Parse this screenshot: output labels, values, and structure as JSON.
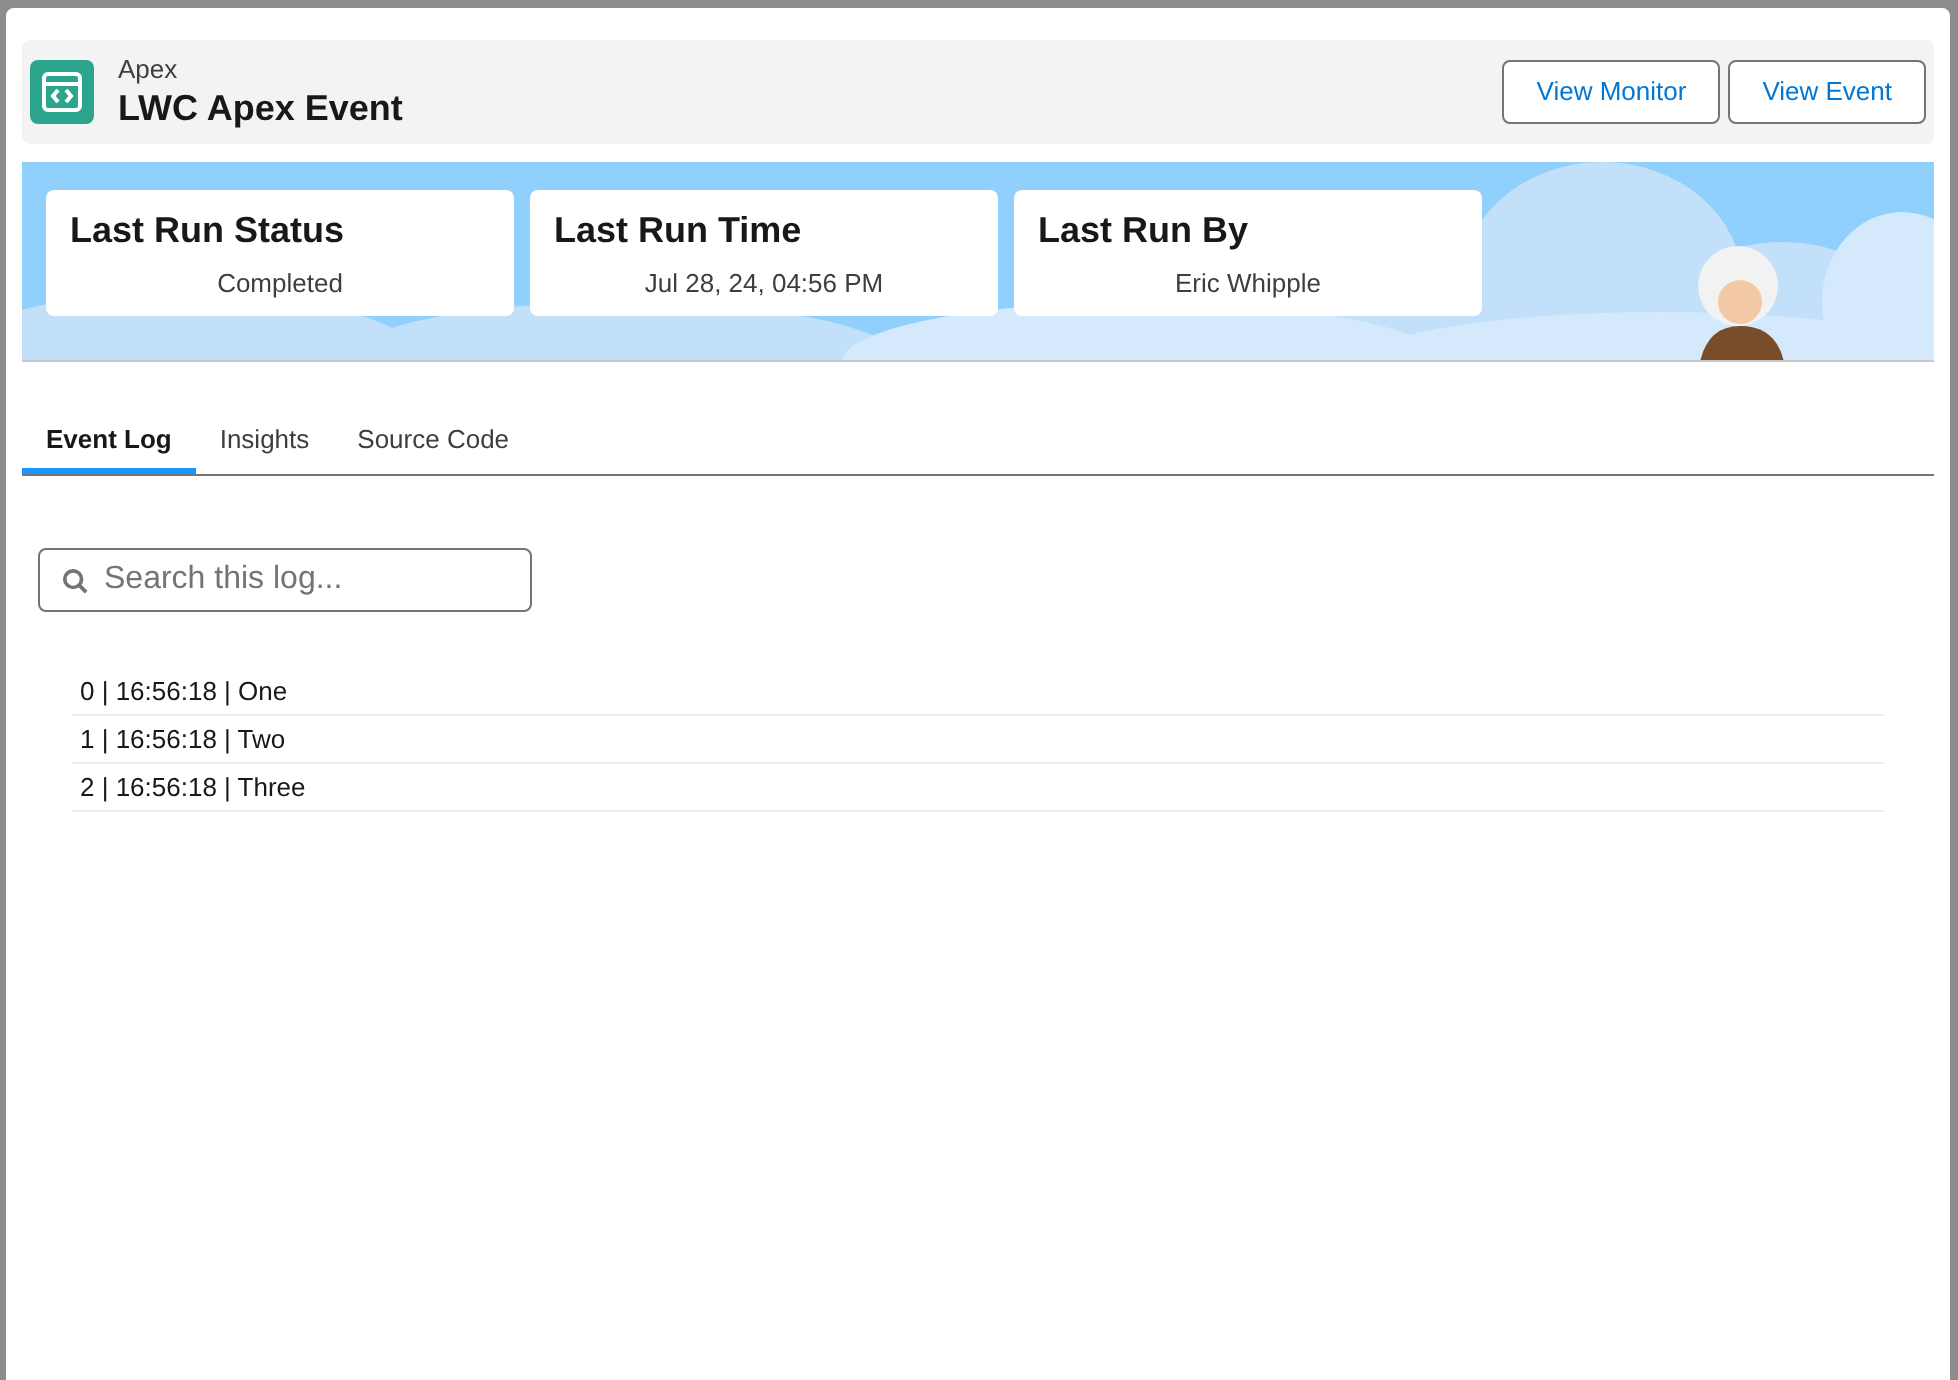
{
  "header": {
    "subtitle": "Apex",
    "title": "LWC Apex Event",
    "buttons": [
      "View Monitor",
      "View Event"
    ]
  },
  "stats": [
    {
      "label": "Last Run Status",
      "value": "Completed"
    },
    {
      "label": "Last Run Time",
      "value": "Jul 28, 24, 04:56 PM"
    },
    {
      "label": "Last Run By",
      "value": "Eric Whipple"
    }
  ],
  "tabs": [
    {
      "label": "Event Log",
      "selected": true
    },
    {
      "label": "Insights",
      "selected": false
    },
    {
      "label": "Source Code",
      "selected": false
    }
  ],
  "search": {
    "placeholder": "Search this log..."
  },
  "log": [
    "0 | 16:56:18 | One",
    "1 | 16:56:18 | Two",
    "2 | 16:56:18 | Three"
  ]
}
